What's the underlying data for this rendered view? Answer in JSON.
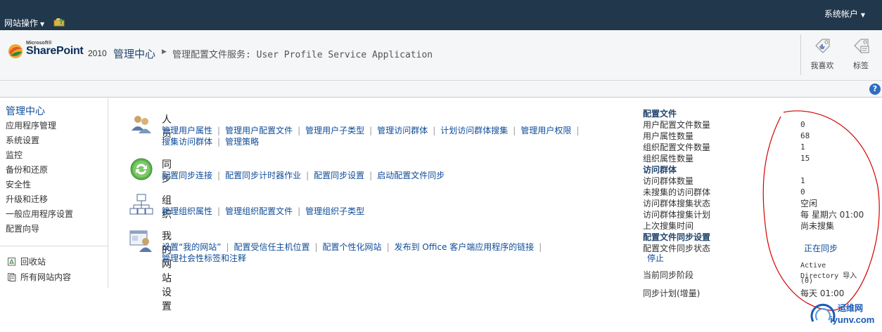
{
  "topbar": {
    "site_actions": "网站操作",
    "account": "系统帐户"
  },
  "header": {
    "logo": {
      "ms": "Microsoft®",
      "word": "SharePoint",
      "version": "2010"
    },
    "breadcrumb_root": "管理中心",
    "breadcrumb_current": "管理配置文件服务: User Profile Service Application",
    "like_label": "我喜欢",
    "tag_label": "标签",
    "help": "?"
  },
  "leftnav": {
    "heading": "管理中心",
    "items": [
      "应用程序管理",
      "系统设置",
      "监控",
      "备份和还原",
      "安全性",
      "升级和迁移",
      "一般应用程序设置",
      "配置向导"
    ],
    "recycle": "回收站",
    "all_content": "所有网站内容"
  },
  "groups": [
    {
      "title": "人员",
      "icon": "people-icon",
      "links": [
        "管理用户属性",
        "管理用户配置文件",
        "管理用户子类型",
        "管理访问群体",
        "计划访问群体搜集",
        "管理用户权限",
        "搜集访问群体",
        "管理策略"
      ]
    },
    {
      "title": "同步",
      "icon": "sync-icon",
      "links": [
        "配置同步连接",
        "配置同步计时器作业",
        "配置同步设置",
        "启动配置文件同步"
      ]
    },
    {
      "title": "组织",
      "icon": "organization-icon",
      "links": [
        "管理组织属性",
        "管理组织配置文件",
        "管理组织子类型"
      ]
    },
    {
      "title": "我的网站设置",
      "icon": "mysite-icon",
      "links": [
        "设置“我的网站”",
        "配置受信任主机位置",
        "配置个性化网站",
        "发布到 Office 客户端应用程序的链接",
        "管理社会性标签和注释"
      ]
    }
  ],
  "stats": {
    "profiles_heading": "配置文件",
    "user_profile_count_label": "用户配置文件数量",
    "user_profile_count": "0",
    "user_property_count_label": "用户属性数量",
    "user_property_count": "68",
    "org_profile_count_label": "组织配置文件数量",
    "org_profile_count": "1",
    "org_property_count_label": "组织属性数量",
    "org_property_count": "15",
    "audiences_heading": "访问群体",
    "audience_count_label": "访问群体数量",
    "audience_count": "1",
    "uncompiled_label": "未搜集的访问群体",
    "uncompiled": "0",
    "compile_status_label": "访问群体搜集状态",
    "compile_status": "空闲",
    "compile_schedule_label": "访问群体搜集计划",
    "compile_schedule": "每 星期六 01:00",
    "last_compile_label": "上次搜集时间",
    "last_compile": "尚未搜集",
    "sync_heading": "配置文件同步设置",
    "sync_status_label": "配置文件同步状态",
    "sync_status": "正在同步",
    "stop_link": "停止",
    "sync_stage_label": "当前同步阶段",
    "sync_stage_1": "Active",
    "sync_stage_2": "Directory 导入",
    "sync_stage_3": "(0)",
    "sync_schedule_label": "同步计划(增量)",
    "sync_schedule": "每天 01:00"
  },
  "watermark": {
    "cn": "运维网",
    "url": "iyunv.com"
  },
  "colors": {
    "topbar": "#21374c",
    "link": "#0f4c98",
    "annotation": "#d40000"
  }
}
